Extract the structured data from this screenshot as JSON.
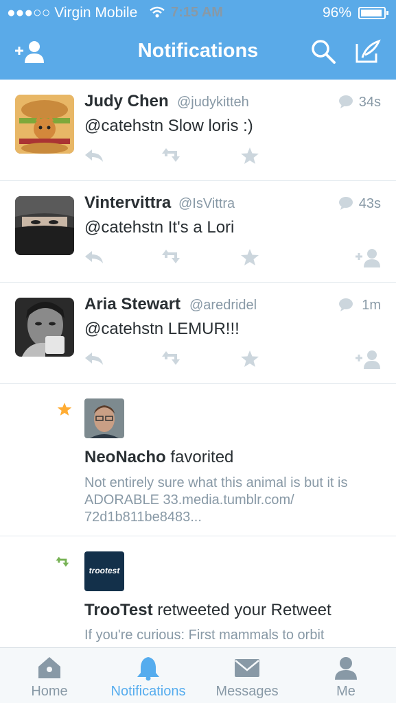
{
  "status_bar": {
    "carrier": "●●●○○ Virgin Mobile",
    "time": "7:15 AM",
    "battery": "96%"
  },
  "header": {
    "title": "Notifications",
    "add_user_icon": "add-user-icon",
    "search_icon": "search-icon",
    "compose_icon": "compose-icon"
  },
  "colors": {
    "brand": "#5aaae8",
    "accent": "#55acee",
    "muted": "#8899a6",
    "text": "#292f33",
    "favorite": "#ffac33",
    "retweet": "#77b255"
  },
  "tweets": [
    {
      "name": "Judy Chen",
      "handle": "@judykitteh",
      "time": "34s",
      "text": "@catehstn Slow loris :)",
      "follow_icon": false
    },
    {
      "name": "Vintervittra",
      "handle": "@IsVittra",
      "time": "43s",
      "text": "@catehstn It's a Lori",
      "follow_icon": true
    },
    {
      "name": "Aria Stewart",
      "handle": "@aredridel",
      "time": "1m",
      "text": "@catehstn LEMUR!!!",
      "follow_icon": true
    }
  ],
  "activities": [
    {
      "type": "favorite",
      "name": "NeoNacho",
      "action": " favorited",
      "body": "Not entirely sure what this animal is but it is ADORABLE 33.media.tumblr.com/ 72d1b811be8483..."
    },
    {
      "type": "retweet",
      "name": "TrooTest",
      "action": " retweeted your Retweet",
      "body": "If you're curious: First mammals to orbit",
      "avatar_text": "trootest"
    }
  ],
  "tabs": [
    {
      "label": "Home",
      "icon": "home-icon",
      "active": false
    },
    {
      "label": "Notifications",
      "icon": "bell-icon",
      "active": true
    },
    {
      "label": "Messages",
      "icon": "envelope-icon",
      "active": false
    },
    {
      "label": "Me",
      "icon": "person-icon",
      "active": false
    }
  ]
}
